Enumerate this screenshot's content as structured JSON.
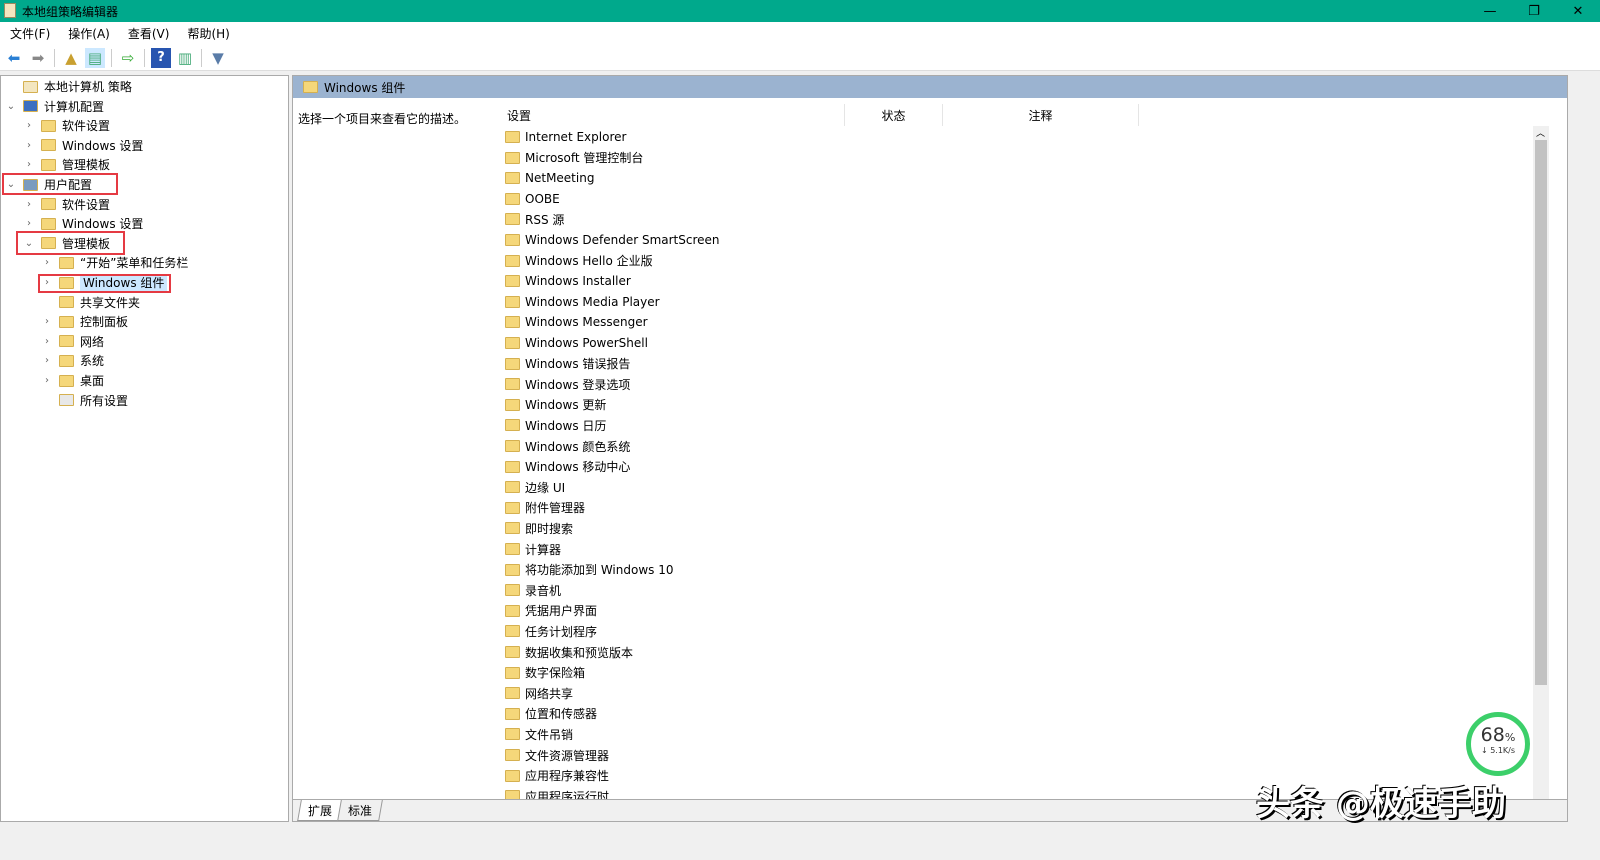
{
  "window": {
    "title": "本地组策略编辑器",
    "minimize": "—",
    "restore": "❐",
    "close": "✕"
  },
  "menu": [
    "文件(F)",
    "操作(A)",
    "查看(V)",
    "帮助(H)"
  ],
  "tree": [
    {
      "label": "本地计算机 策略",
      "level": 0,
      "chev": "",
      "icon": "policy"
    },
    {
      "label": "计算机配置",
      "level": 0,
      "chev": "v",
      "icon": "computer"
    },
    {
      "label": "软件设置",
      "level": 1,
      "chev": ">",
      "icon": "folder"
    },
    {
      "label": "Windows 设置",
      "level": 1,
      "chev": ">",
      "icon": "folder"
    },
    {
      "label": "管理模板",
      "level": 1,
      "chev": ">",
      "icon": "folder"
    },
    {
      "label": "用户配置",
      "level": 0,
      "chev": "v",
      "icon": "user"
    },
    {
      "label": "软件设置",
      "level": 1,
      "chev": ">",
      "icon": "folder"
    },
    {
      "label": "Windows 设置",
      "level": 1,
      "chev": ">",
      "icon": "folder"
    },
    {
      "label": "管理模板",
      "level": 1,
      "chev": "v",
      "icon": "folder"
    },
    {
      "label": "“开始”菜单和任务栏",
      "level": 2,
      "chev": ">",
      "icon": "folder"
    },
    {
      "label": "Windows 组件",
      "level": 2,
      "chev": ">",
      "icon": "folder",
      "selected": true
    },
    {
      "label": "共享文件夹",
      "level": 2,
      "chev": "",
      "icon": "folder"
    },
    {
      "label": "控制面板",
      "level": 2,
      "chev": ">",
      "icon": "folder"
    },
    {
      "label": "网络",
      "level": 2,
      "chev": ">",
      "icon": "folder"
    },
    {
      "label": "系统",
      "level": 2,
      "chev": ">",
      "icon": "folder"
    },
    {
      "label": "桌面",
      "level": 2,
      "chev": ">",
      "icon": "folder"
    },
    {
      "label": "所有设置",
      "level": 2,
      "chev": "",
      "icon": "settings"
    }
  ],
  "right": {
    "header": "Windows 组件",
    "description": "选择一个项目来查看它的描述。",
    "columns": [
      "设置",
      "状态",
      "注释"
    ],
    "items": [
      "Internet Explorer",
      "Microsoft 管理控制台",
      "NetMeeting",
      "OOBE",
      "RSS 源",
      "Windows Defender SmartScreen",
      "Windows Hello 企业版",
      "Windows Installer",
      "Windows Media Player",
      "Windows Messenger",
      "Windows PowerShell",
      "Windows 错误报告",
      "Windows 登录选项",
      "Windows 更新",
      "Windows 日历",
      "Windows 颜色系统",
      "Windows 移动中心",
      "边缘 UI",
      "附件管理器",
      "即时搜索",
      "计算器",
      "将功能添加到 Windows 10",
      "录音机",
      "凭据用户界面",
      "任务计划程序",
      "数据收集和预览版本",
      "数字保险箱",
      "网络共享",
      "位置和传感器",
      "文件吊销",
      "文件资源管理器",
      "应用程序兼容性",
      "应用程序运行时"
    ],
    "tabs": [
      "扩展",
      "标准"
    ]
  },
  "overlay": {
    "percent": "68",
    "unit": "%",
    "speed": "↓ 5.1K/s",
    "watermark": "头条 @极速手助"
  },
  "colors": {
    "titlebar": "#00a98c",
    "highlight": "#e53a43",
    "header": "#9bb3d0"
  }
}
